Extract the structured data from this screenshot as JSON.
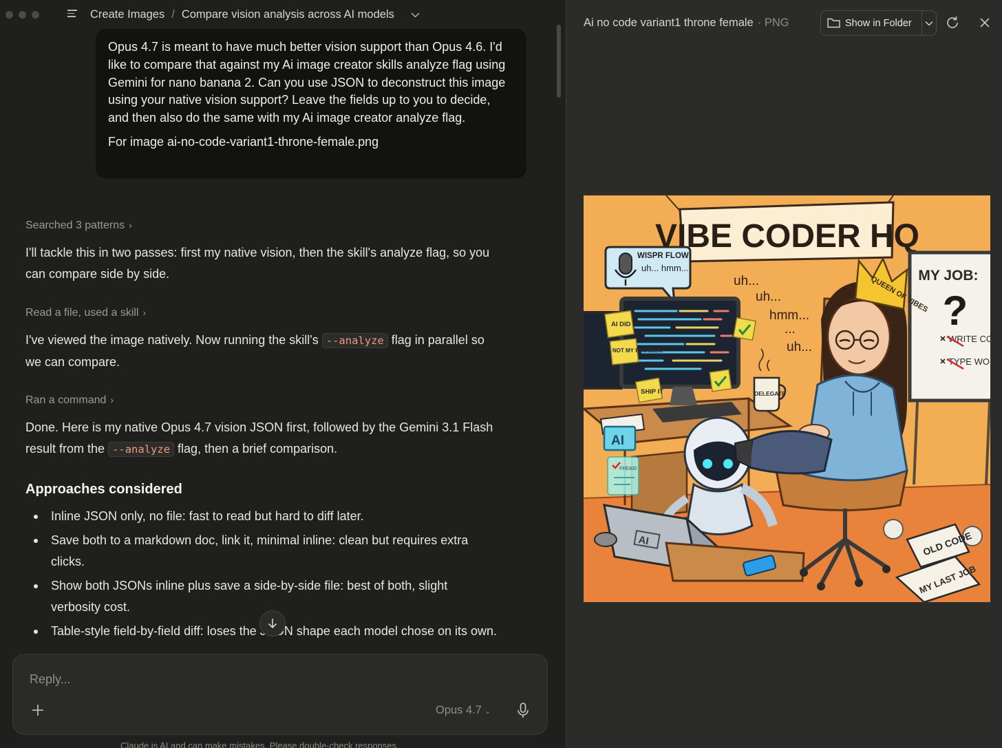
{
  "breadcrumb": {
    "project": "Create Images",
    "separator": "/",
    "conversation": "Compare vision analysis across AI models"
  },
  "user_message": {
    "body": "Opus 4.7 is meant to have much better vision support than Opus 4.6. I'd like to compare that against my Ai image creator skills analyze flag using Gemini for nano banana 2. Can you use JSON to deconstruct this image using your native vision support? Leave the fields up to you to decide, and then also do the same with my Ai image creator analyze flag.",
    "footer": "For image ai-no-code-variant1-throne-female.png"
  },
  "steps": {
    "s1": "Searched 3 patterns",
    "s2": "Read a file, used a skill",
    "s3": "Ran a command"
  },
  "assistant": {
    "p1": "I'll tackle this in two passes: first my native vision, then the skill's analyze flag, so you can compare side by side.",
    "p2_a": "I've viewed the image natively. Now running the skill's ",
    "p2_code": "--analyze",
    "p2_b": " flag in parallel so we can compare.",
    "p3_a": "Done. Here is my native Opus 4.7 vision JSON first, followed by the Gemini 3.1 Flash result from the ",
    "p3_code": "--analyze",
    "p3_b": " flag, then a brief comparison.",
    "heading": "Approaches considered",
    "bullets": [
      "Inline JSON only, no file: fast to read but hard to diff later.",
      "Save both to a markdown doc, link it, minimal inline: clean but requires extra clicks.",
      "Show both JSONs inline plus save a side-by-side file: best of both, slight verbosity cost.",
      "Table-style field-by-field diff: loses the JSON shape each model chose on its own."
    ]
  },
  "composer": {
    "placeholder": "Reply...",
    "model": "Opus 4.7",
    "disclaimer": "Claude is AI and can make mistakes. Please double-check responses."
  },
  "preview_panel": {
    "file_name": "Ai no code variant1 throne female",
    "file_type": "· PNG",
    "show_in_folder": "Show in Folder"
  },
  "illustration": {
    "banner": "VIBE CODER HQ",
    "bubble_title": "WISPR FLOW",
    "bubble_text": "uh... hmm...",
    "floating_words": [
      "uh...",
      "uh...",
      "hmm...",
      "...",
      "uh..."
    ],
    "crown": "QUEEN OF VIBES",
    "whiteboard_title": "MY JOB:",
    "whiteboard_qmark": "?",
    "whiteboard_items": [
      "WRITE CODE",
      "TYPE WORDS"
    ],
    "sticky_notes": [
      "AI DID IT",
      "NOT MY PROBLEM",
      "SHIP IT"
    ],
    "mug": "DELEGATE",
    "laptop_logo": "AI",
    "folder_label": "AI",
    "hex_note": "FFE000",
    "papers": [
      "OLD CODE",
      "MY LAST JOB"
    ]
  }
}
